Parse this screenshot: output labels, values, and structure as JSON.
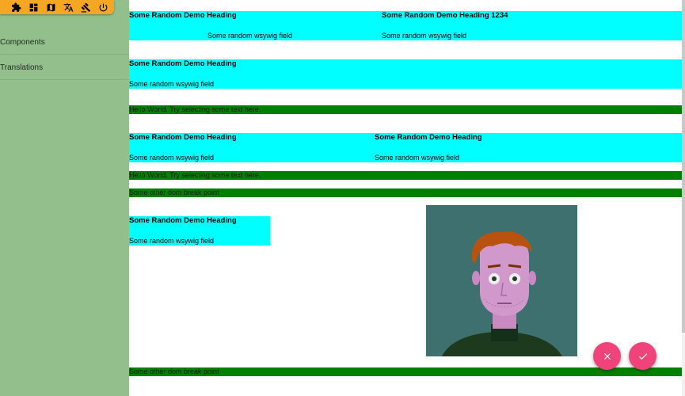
{
  "toolbar": {
    "icons": [
      "puzzle-icon",
      "dashboard-icon",
      "map-icon",
      "translate-icon",
      "gavel-icon",
      "power-icon"
    ]
  },
  "sidebar": {
    "items": [
      {
        "label": "Components"
      },
      {
        "label": "Translations"
      }
    ]
  },
  "sections": {
    "row1": {
      "left": {
        "heading": "Some Random Demo Heading",
        "field": "Some random wsywig field"
      },
      "right": {
        "heading": "Some Random Demo Heading 1234",
        "field": "Some random wsywig field"
      }
    },
    "row2": {
      "heading": "Some Random Demo Heading",
      "field": "Some random wsywig field"
    },
    "green1": "Hello World. Try selecting some text here.",
    "row3": {
      "left": {
        "heading": "Some Random Demo Heading",
        "field": "Some random wsywig field"
      },
      "right": {
        "heading": "Some Random Demo Heading",
        "field": "Some random wsywig field"
      }
    },
    "green2": "Hello World. Try selecting some text here.",
    "green3": "Some other dom break point",
    "row4": {
      "heading": "Some Random Demo Heading",
      "field": "Some random wsywig field"
    },
    "green4": "Some other dom break point"
  },
  "colors": {
    "sidebar": "#93bf8d",
    "toolbar": "#f5a623",
    "block": "#00ffff",
    "breakpoint": "#008000",
    "fab": "#f0437b"
  },
  "fabs": {
    "cancel": "close-icon",
    "confirm": "check-icon"
  }
}
